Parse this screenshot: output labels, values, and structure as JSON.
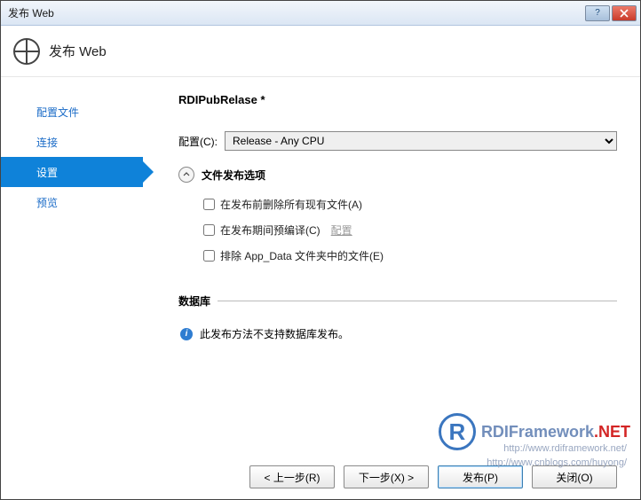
{
  "titlebar": {
    "text": "发布 Web"
  },
  "header": {
    "title": "发布 Web"
  },
  "sidebar": {
    "items": [
      {
        "label": "配置文件",
        "active": false
      },
      {
        "label": "连接",
        "active": false
      },
      {
        "label": "设置",
        "active": true
      },
      {
        "label": "预览",
        "active": false
      }
    ]
  },
  "profile": {
    "name": "RDIPubRelase *"
  },
  "config": {
    "label": "配置(C):",
    "options": [
      "Release - Any CPU"
    ],
    "selected": "Release - Any CPU"
  },
  "fileOptions": {
    "header": "文件发布选项",
    "deleteAll": {
      "label": "在发布前删除所有现有文件(A)",
      "checked": false
    },
    "precompile": {
      "label": "在发布期间预编译(C)",
      "checked": false,
      "link": "配置"
    },
    "excludeAppData": {
      "label": "排除 App_Data 文件夹中的文件(E)",
      "checked": false
    }
  },
  "database": {
    "header": "数据库",
    "info": "此发布方法不支持数据库发布。"
  },
  "footer": {
    "prev": "< 上一步(R)",
    "next": "下一步(X) >",
    "publish": "发布(P)",
    "close": "关闭(O)"
  },
  "watermark": {
    "brand": "RDIFramework",
    "suffix": ".NET",
    "url1": "http://www.rdiframework.net/",
    "url2": "http://www.cnblogs.com/huyong/"
  }
}
